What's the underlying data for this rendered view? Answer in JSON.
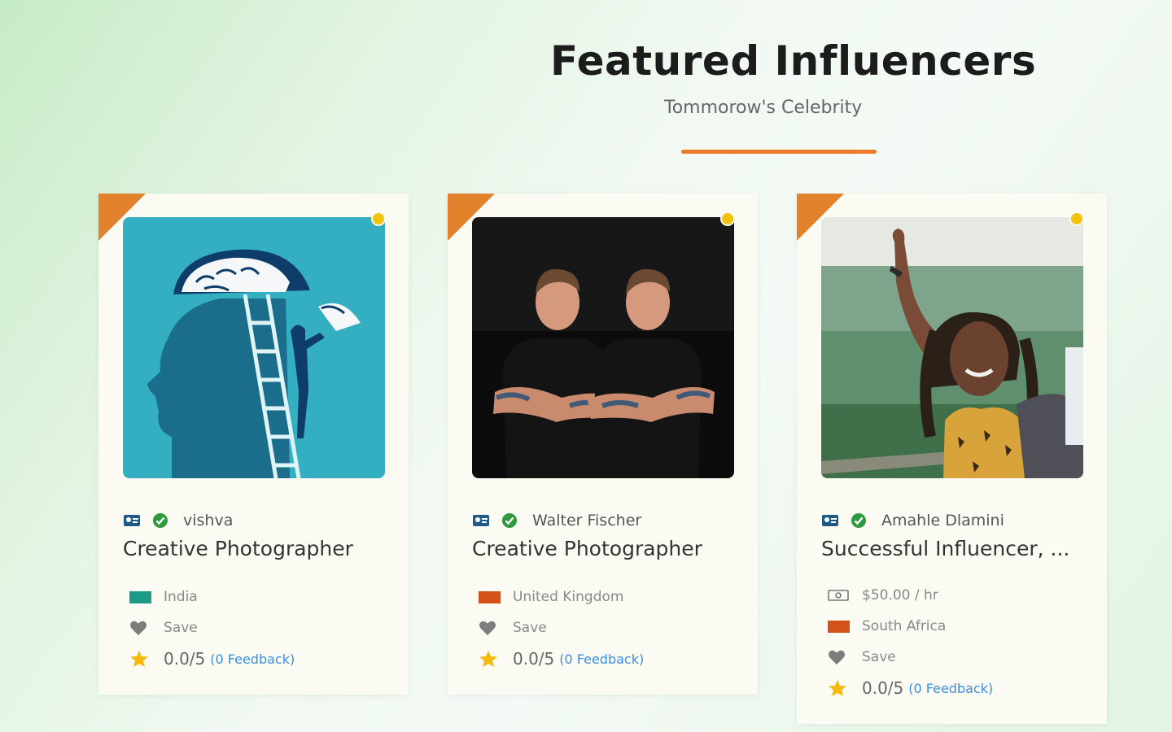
{
  "header": {
    "title": "Featured Influencers",
    "subtitle": "Tommorow's Celebrity",
    "accent": "#ee7a2c"
  },
  "theme": {
    "corner_color": "#e2822c",
    "online_dot_color": "#f3c20d",
    "feedback_link_color": "#3a8ee0",
    "verify_icon_color": "#2e9a3c"
  },
  "cards": [
    {
      "name": "vishva",
      "role": "Creative Photographer",
      "photo_subject": "illustration of a head with a brain puzzle and a person on a ladder",
      "rate": "",
      "country": "India",
      "flag_color": "#1b9a86",
      "save_label": "Save",
      "rating": "0.0/5",
      "feedback": "(0 Feedback)"
    },
    {
      "name": "Walter Fischer",
      "role": "Creative Photographer",
      "photo_subject": "two men in black t-shirts with arms crossed",
      "rate": "",
      "country": "United Kingdom",
      "flag_color": "#d2521a",
      "save_label": "Save",
      "rating": "0.0/5",
      "feedback": "(0 Feedback)"
    },
    {
      "name": "Amahle Dlamini",
      "role": "Successful Influencer, ...",
      "photo_subject": "woman taking a selfie in front of a lake",
      "rate": "$50.00 / hr",
      "country": "South Africa",
      "flag_color": "#d2521a",
      "save_label": "Save",
      "rating": "0.0/5",
      "feedback": "(0 Feedback)"
    }
  ],
  "icons": {
    "badge": "id-card-icon",
    "verified": "verified-check-icon",
    "rate": "money-icon",
    "save": "heart-icon",
    "rating": "star-icon"
  }
}
